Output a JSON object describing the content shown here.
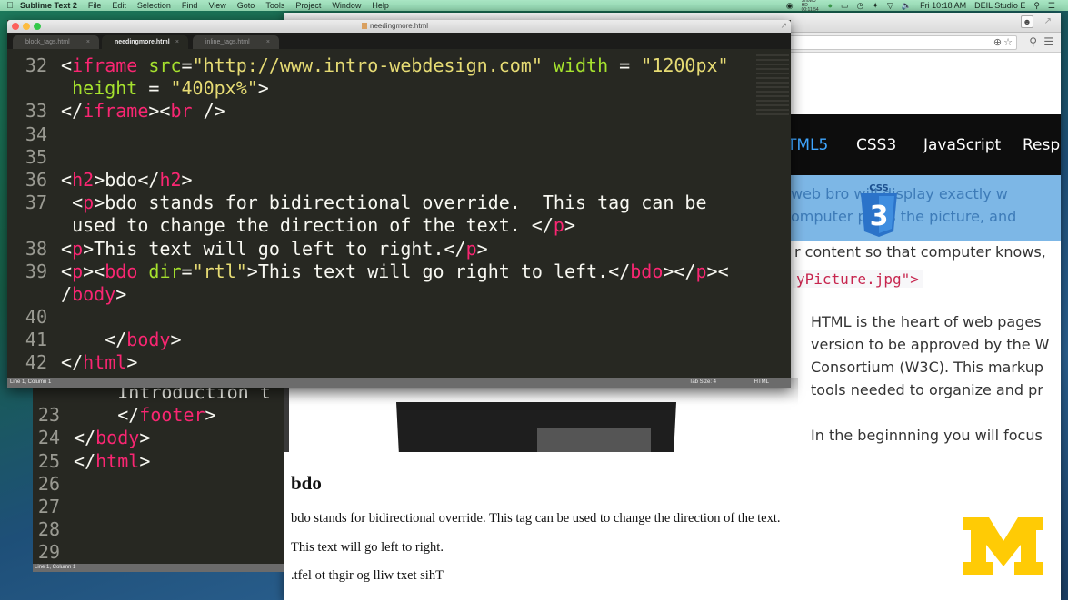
{
  "menubar": {
    "app_name": "Sublime Text 2",
    "menus": [
      "File",
      "Edit",
      "Selection",
      "Find",
      "View",
      "Goto",
      "Tools",
      "Project",
      "Window",
      "Help"
    ],
    "status_text": "ShowU HD 00:11:54",
    "clock": "Fri 10:18 AM",
    "user": "DEIL Studio E"
  },
  "editor": {
    "window_title": "needingmore.html",
    "tabs": [
      {
        "label": "block_tags.html",
        "active": false
      },
      {
        "label": "needingmore.html",
        "active": true
      },
      {
        "label": "inline_tags.html",
        "active": false
      }
    ],
    "lines": [
      {
        "n": "32",
        "segments": [
          [
            "p",
            "<"
          ],
          [
            "t",
            "iframe"
          ],
          [
            "p",
            " "
          ],
          [
            "a",
            "src"
          ],
          [
            "p",
            "="
          ],
          [
            "s",
            "\"http://www.intro-webdesign.com\""
          ],
          [
            "p",
            " "
          ],
          [
            "a",
            "width"
          ],
          [
            "p",
            " = "
          ],
          [
            "s",
            "\"1200px\""
          ]
        ]
      },
      {
        "n": "",
        "segments": [
          [
            "p",
            " "
          ],
          [
            "a",
            "height"
          ],
          [
            "p",
            " = "
          ],
          [
            "s",
            "\"400px%\""
          ],
          [
            "p",
            ">"
          ]
        ]
      },
      {
        "n": "33",
        "segments": [
          [
            "p",
            "</"
          ],
          [
            "t",
            "iframe"
          ],
          [
            "p",
            "><"
          ],
          [
            "t",
            "br"
          ],
          [
            "p",
            " />"
          ]
        ]
      },
      {
        "n": "34",
        "segments": []
      },
      {
        "n": "35",
        "segments": []
      },
      {
        "n": "36",
        "segments": [
          [
            "p",
            "<"
          ],
          [
            "t",
            "h2"
          ],
          [
            "p",
            ">bdo</"
          ],
          [
            "t",
            "h2"
          ],
          [
            "p",
            ">"
          ]
        ]
      },
      {
        "n": "37",
        "segments": [
          [
            "p",
            " <"
          ],
          [
            "t",
            "p"
          ],
          [
            "p",
            ">bdo stands for bidirectional override.  This tag can be"
          ]
        ]
      },
      {
        "n": "",
        "segments": [
          [
            "p",
            " used to change the direction of the text. </"
          ],
          [
            "t",
            "p"
          ],
          [
            "p",
            ">"
          ]
        ]
      },
      {
        "n": "38",
        "segments": [
          [
            "p",
            "<"
          ],
          [
            "t",
            "p"
          ],
          [
            "p",
            ">This text will go left to right.</"
          ],
          [
            "t",
            "p"
          ],
          [
            "p",
            ">"
          ]
        ]
      },
      {
        "n": "39",
        "segments": [
          [
            "p",
            "<"
          ],
          [
            "t",
            "p"
          ],
          [
            "p",
            "><"
          ],
          [
            "t",
            "bdo"
          ],
          [
            "p",
            " "
          ],
          [
            "a",
            "dir"
          ],
          [
            "p",
            "="
          ],
          [
            "s",
            "\"rtl\""
          ],
          [
            "p",
            ">This text will go right to left.</"
          ],
          [
            "t",
            "bdo"
          ],
          [
            "p",
            "></"
          ],
          [
            "t",
            "p"
          ],
          [
            "p",
            "><"
          ]
        ]
      },
      {
        "n": "",
        "segments": [
          [
            "p",
            "/"
          ],
          [
            "t",
            "body"
          ],
          [
            "p",
            ">"
          ]
        ]
      },
      {
        "n": "40",
        "segments": []
      },
      {
        "n": "41",
        "segments": [
          [
            "p",
            "    </"
          ],
          [
            "t",
            "body"
          ],
          [
            "p",
            ">"
          ]
        ]
      },
      {
        "n": "42",
        "segments": [
          [
            "p",
            "</"
          ],
          [
            "t",
            "html"
          ],
          [
            "p",
            ">"
          ]
        ]
      }
    ],
    "status_left": "Line 1, Column 1",
    "tab_size": "Tab Size: 4",
    "syntax": "HTML"
  },
  "editor_back": {
    "lines": [
      {
        "n": "",
        "segments": [
          [
            "p",
            "    Introduction t"
          ]
        ]
      },
      {
        "n": "23",
        "segments": [
          [
            "p",
            "    </"
          ],
          [
            "t",
            "footer"
          ],
          [
            "p",
            ">"
          ]
        ]
      },
      {
        "n": "24",
        "segments": [
          [
            "p",
            "</"
          ],
          [
            "t",
            "body"
          ],
          [
            "p",
            ">"
          ]
        ]
      },
      {
        "n": "25",
        "segments": [
          [
            "p",
            "</"
          ],
          [
            "t",
            "html"
          ],
          [
            "p",
            ">"
          ]
        ]
      },
      {
        "n": "26",
        "segments": []
      },
      {
        "n": "27",
        "segments": []
      },
      {
        "n": "28",
        "segments": []
      },
      {
        "n": "29",
        "segments": []
      }
    ],
    "status_left": "Line 1, Column 1"
  },
  "site": {
    "nav": [
      {
        "label": "TML5",
        "active": true
      },
      {
        "label": "CSS3",
        "active": false
      },
      {
        "label": "JavaScript",
        "active": false
      },
      {
        "label": "Resp",
        "active": false
      }
    ],
    "css_badge": "CSS",
    "css_badge_number": "3",
    "hero_lines": [
      "web bro        will display exactly w",
      "omputer      plays the picture, and"
    ],
    "content_line": "r content so that computer knows,",
    "code_snippet": "yPicture.jpg\">",
    "paragraph1": [
      "HTML is the heart of web pages",
      "version to be approved by the W",
      "Consortium (W3C). This markup",
      "tools needed to organize and pr"
    ],
    "paragraph2": "In the beginnning you will focus"
  },
  "rendered": {
    "heading": "bdo",
    "p1": "bdo stands for bidirectional override. This tag can be used to change the direction of the text.",
    "p2": "This text will go left to right.",
    "p3": "This text will go right to left."
  },
  "colors": {
    "tag": "#f92672",
    "attr": "#a6e22e",
    "string": "#e6db74",
    "editor_bg": "#272822",
    "umich_maize": "#ffcb05",
    "nav_active": "#3fa6ff"
  }
}
